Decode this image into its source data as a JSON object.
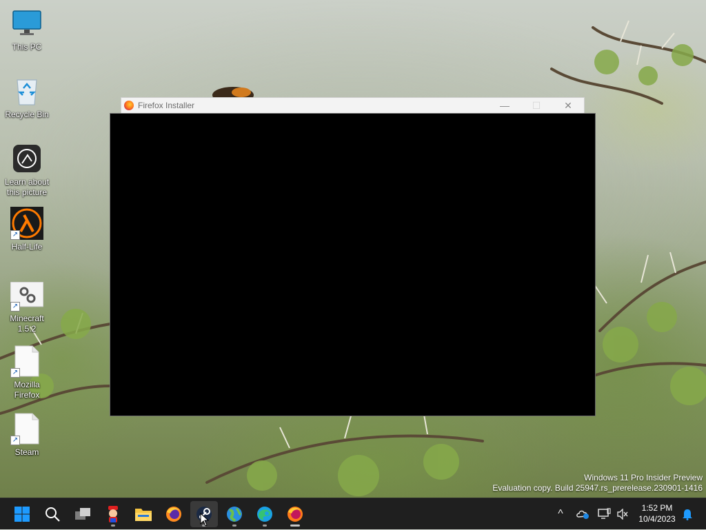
{
  "desktop": {
    "icons": [
      {
        "label": "This PC",
        "icon": "monitor-icon"
      },
      {
        "label": "Recycle Bin",
        "icon": "recycle-bin-icon"
      },
      {
        "label": "Learn about\nthis picture",
        "icon": "camera-icon"
      },
      {
        "label": "Half-Life",
        "icon": "half-life-lambda-icon"
      },
      {
        "label": "Minecraft\n1.5.2",
        "icon": "gear-settings-icon"
      },
      {
        "label": "Mozilla\nFirefox",
        "icon": "blank-file-icon"
      },
      {
        "label": "Steam",
        "icon": "blank-file-icon"
      }
    ]
  },
  "window": {
    "title": "Firefox Installer",
    "minimize_glyph": "—",
    "maximize_glyph": "☐",
    "close_glyph": "✕"
  },
  "watermark": {
    "line1": "Windows 11 Pro Insider Preview",
    "line2": "Evaluation copy. Build 25947.rs_prerelease.230901-1416"
  },
  "taskbar": {
    "apps": [
      {
        "name": "start",
        "icon": "windows-logo-icon"
      },
      {
        "name": "search",
        "icon": "search-icon"
      },
      {
        "name": "task-view",
        "icon": "task-view-icon"
      },
      {
        "name": "mario-app",
        "icon": "mario-icon"
      },
      {
        "name": "file-explorer",
        "icon": "folder-icon"
      },
      {
        "name": "firefox",
        "icon": "firefox-icon"
      },
      {
        "name": "steam",
        "icon": "steam-icon"
      },
      {
        "name": "globe-app",
        "icon": "globe-icon"
      },
      {
        "name": "edge",
        "icon": "edge-icon"
      },
      {
        "name": "firefox-installer",
        "icon": "firefox-icon"
      }
    ],
    "tray": {
      "overflow_glyph": "^",
      "time": "1:52 PM",
      "date": "10/4/2023"
    }
  },
  "colors": {
    "taskbar_bg": "#1f1f1f",
    "accent_blue": "#0a84ff",
    "window_titlebar": "#f3f3f3"
  }
}
